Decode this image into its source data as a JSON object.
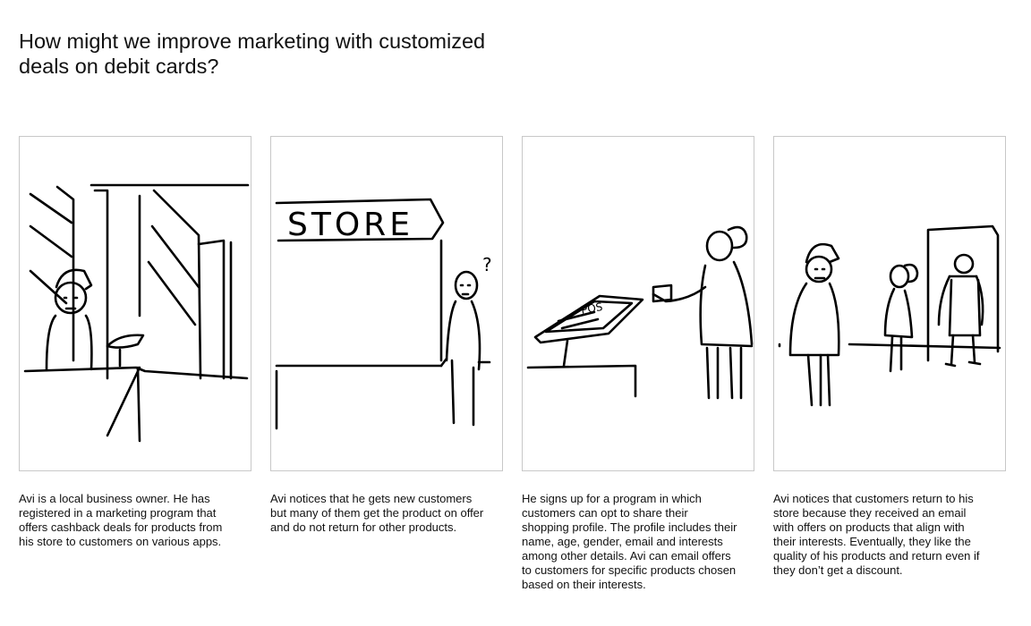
{
  "header": {
    "title": "How might we improve marketing with customized deals on debit cards?"
  },
  "storyboard": {
    "panels": [
      {
        "caption": "Avi is a local business owner. He has registered in a marketing program that offers cashback deals for products from his store to customers on various apps."
      },
      {
        "caption": "Avi notices that he gets new customers but many of them get the product on offer and do not return for other products.",
        "sign_text": "STORE",
        "question_mark": "?"
      },
      {
        "caption": "He signs up for a program in which customers can opt to share their shopping profile. The profile includes their name, age, gender, email and interests among other details. Avi can email offers to customers for specific products chosen based on their interests.",
        "terminal_text": "POS"
      },
      {
        "caption": "Avi notices that customers return to his store because they received an email with offers on products that align with their interests. Eventually, they like the quality of his products and return even if they don’t get a discount."
      }
    ]
  }
}
